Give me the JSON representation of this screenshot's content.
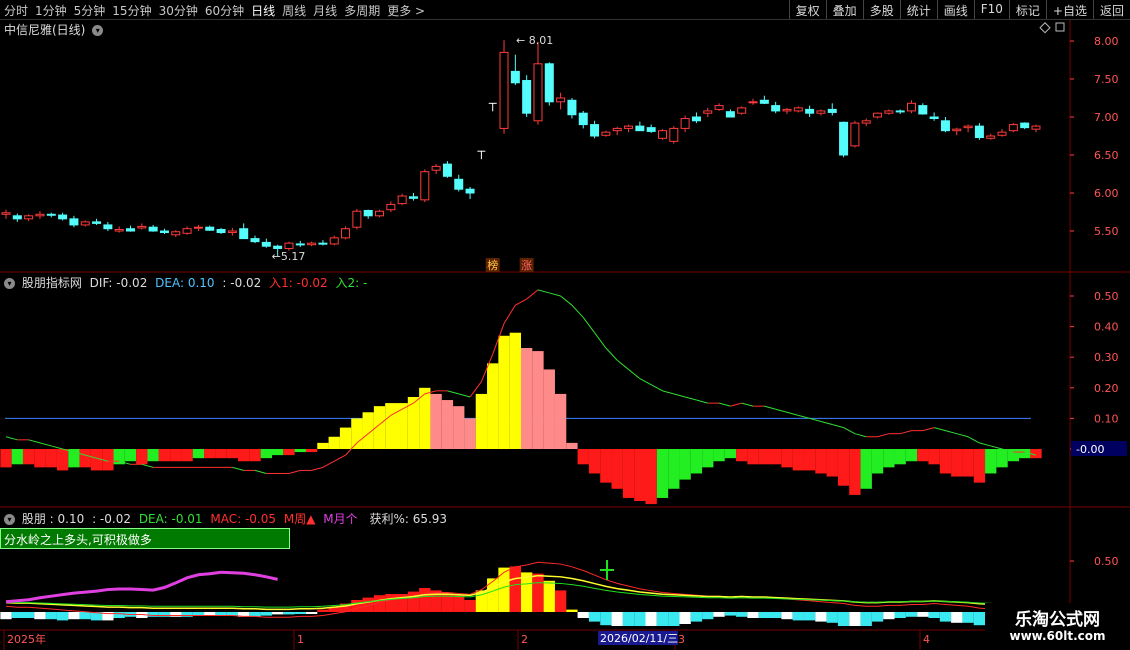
{
  "toolbar": {
    "periods": [
      "分时",
      "1分钟",
      "5分钟",
      "15分钟",
      "30分钟",
      "60分钟",
      "日线",
      "周线",
      "月线",
      "多周期",
      "更多 >"
    ],
    "active_period": "日线",
    "right_buttons": [
      "复权",
      "叠加",
      "多股",
      "统计",
      "画线",
      "F10",
      "标记",
      "+自选",
      "返回"
    ]
  },
  "main": {
    "title": "中信尼雅(日线)",
    "y_ticks": [
      "8.00",
      "7.50",
      "7.00",
      "6.50",
      "6.00",
      "5.50"
    ],
    "high_label": "8.01",
    "low_label": "5.17",
    "badges": [
      "榜",
      "涨"
    ]
  },
  "macd_panel": {
    "title": "股朋指标网",
    "dif_label": "DIF: -0.02",
    "dea_label": "DEA: 0.10",
    "extra1": ": -0.02",
    "entry1": "入1: -0.02",
    "entry2": "入2: -",
    "y_ticks": [
      "0.50",
      "0.40",
      "0.30",
      "0.20",
      "0.10",
      "-0.00"
    ],
    "current_value": "-0.00"
  },
  "bottom_panel": {
    "title": "股朋",
    "val1": ": 0.10",
    "val2": ": -0.02",
    "dea": "DEA: -0.01",
    "mac": "MAC: -0.05",
    "week": "M周▲",
    "month": "M月个",
    "profit": "获利%: 65.93",
    "status_text": "分水岭之上多头,可积极做多",
    "y_tick": "0.50"
  },
  "time_axis": {
    "labels": [
      "2025年",
      "1",
      "2",
      "3",
      "4"
    ],
    "cursor_date": "2026/02/11/三"
  },
  "watermark": {
    "title": "乐淘公式网",
    "url": "www.60lt.com"
  },
  "chart_data": {
    "type": "candlestick",
    "candles": [
      [
        5.72,
        5.78,
        5.66,
        5.74
      ],
      [
        5.7,
        5.73,
        5.62,
        5.66
      ],
      [
        5.66,
        5.72,
        5.63,
        5.7
      ],
      [
        5.7,
        5.76,
        5.66,
        5.72
      ],
      [
        5.72,
        5.74,
        5.68,
        5.71
      ],
      [
        5.71,
        5.74,
        5.64,
        5.66
      ],
      [
        5.66,
        5.7,
        5.55,
        5.58
      ],
      [
        5.58,
        5.64,
        5.56,
        5.62
      ],
      [
        5.62,
        5.66,
        5.58,
        5.6
      ],
      [
        5.58,
        5.62,
        5.5,
        5.53
      ],
      [
        5.5,
        5.56,
        5.48,
        5.52
      ],
      [
        5.53,
        5.57,
        5.49,
        5.5
      ],
      [
        5.54,
        5.6,
        5.52,
        5.56
      ],
      [
        5.55,
        5.58,
        5.49,
        5.5
      ],
      [
        5.5,
        5.53,
        5.46,
        5.48
      ],
      [
        5.45,
        5.51,
        5.42,
        5.49
      ],
      [
        5.47,
        5.56,
        5.45,
        5.53
      ],
      [
        5.54,
        5.58,
        5.5,
        5.55
      ],
      [
        5.55,
        5.57,
        5.5,
        5.51
      ],
      [
        5.52,
        5.54,
        5.46,
        5.48
      ],
      [
        5.48,
        5.54,
        5.44,
        5.5
      ],
      [
        5.53,
        5.6,
        5.5,
        5.4
      ],
      [
        5.4,
        5.44,
        5.34,
        5.36
      ],
      [
        5.35,
        5.4,
        5.28,
        5.3
      ],
      [
        5.3,
        5.32,
        5.17,
        5.27
      ],
      [
        5.27,
        5.36,
        5.24,
        5.34
      ],
      [
        5.33,
        5.37,
        5.29,
        5.32
      ],
      [
        5.32,
        5.36,
        5.3,
        5.34
      ],
      [
        5.34,
        5.38,
        5.31,
        5.33
      ],
      [
        5.33,
        5.44,
        5.31,
        5.41
      ],
      [
        5.41,
        5.56,
        5.39,
        5.53
      ],
      [
        5.55,
        5.79,
        5.52,
        5.76
      ],
      [
        5.77,
        5.78,
        5.66,
        5.7
      ],
      [
        5.7,
        5.78,
        5.68,
        5.76
      ],
      [
        5.78,
        5.89,
        5.75,
        5.85
      ],
      [
        5.86,
        5.99,
        5.84,
        5.96
      ],
      [
        5.95,
        6.0,
        5.9,
        5.93
      ],
      [
        5.91,
        6.31,
        5.88,
        6.28
      ],
      [
        6.3,
        6.38,
        6.25,
        6.35
      ],
      [
        6.38,
        6.42,
        6.2,
        6.22
      ],
      [
        6.18,
        6.24,
        6.02,
        6.05
      ],
      [
        6.05,
        6.08,
        5.92,
        6.0
      ],
      [
        6.55,
        6.55,
        6.55,
        6.55
      ],
      [
        7.18,
        7.18,
        7.18,
        7.18
      ],
      [
        6.85,
        8.01,
        6.78,
        7.85
      ],
      [
        7.6,
        7.82,
        7.42,
        7.45
      ],
      [
        7.48,
        7.55,
        7.0,
        7.05
      ],
      [
        6.95,
        7.99,
        6.9,
        7.7
      ],
      [
        7.7,
        7.72,
        7.15,
        7.2
      ],
      [
        7.2,
        7.32,
        7.1,
        7.25
      ],
      [
        7.22,
        7.25,
        6.98,
        7.03
      ],
      [
        7.05,
        7.08,
        6.85,
        6.9
      ],
      [
        6.9,
        6.95,
        6.72,
        6.75
      ],
      [
        6.76,
        6.82,
        6.74,
        6.8
      ],
      [
        6.82,
        6.87,
        6.76,
        6.85
      ],
      [
        6.85,
        6.9,
        6.8,
        6.88
      ],
      [
        6.88,
        6.94,
        6.82,
        6.82
      ],
      [
        6.86,
        6.9,
        6.79,
        6.81
      ],
      [
        6.72,
        6.84,
        6.7,
        6.82
      ],
      [
        6.68,
        6.88,
        6.65,
        6.85
      ],
      [
        6.85,
        7.02,
        6.8,
        6.98
      ],
      [
        7.0,
        7.06,
        6.92,
        6.95
      ],
      [
        7.05,
        7.12,
        7.0,
        7.08
      ],
      [
        7.1,
        7.18,
        7.08,
        7.15
      ],
      [
        7.07,
        7.1,
        7.0,
        7.0
      ],
      [
        7.05,
        7.14,
        7.03,
        7.12
      ],
      [
        7.2,
        7.24,
        7.16,
        7.2
      ],
      [
        7.22,
        7.28,
        7.17,
        7.18
      ],
      [
        7.15,
        7.2,
        7.05,
        7.08
      ],
      [
        7.08,
        7.12,
        7.04,
        7.1
      ],
      [
        7.08,
        7.14,
        7.06,
        7.12
      ],
      [
        7.1,
        7.15,
        7.0,
        7.05
      ],
      [
        7.05,
        7.1,
        7.02,
        7.08
      ],
      [
        7.1,
        7.18,
        7.02,
        7.06
      ],
      [
        6.93,
        6.94,
        6.47,
        6.5
      ],
      [
        6.62,
        6.95,
        6.6,
        6.92
      ],
      [
        6.92,
        6.98,
        6.88,
        6.95
      ],
      [
        7.0,
        7.06,
        6.98,
        7.05
      ],
      [
        7.05,
        7.1,
        7.03,
        7.08
      ],
      [
        7.08,
        7.1,
        7.04,
        7.07
      ],
      [
        7.08,
        7.22,
        7.05,
        7.18
      ],
      [
        7.15,
        7.18,
        7.03,
        7.04
      ],
      [
        7.0,
        7.06,
        6.95,
        6.98
      ],
      [
        6.95,
        7.0,
        6.8,
        6.82
      ],
      [
        6.82,
        6.86,
        6.76,
        6.84
      ],
      [
        6.86,
        6.9,
        6.8,
        6.88
      ],
      [
        6.88,
        6.92,
        6.7,
        6.73
      ],
      [
        6.72,
        6.78,
        6.7,
        6.75
      ],
      [
        6.76,
        6.84,
        6.74,
        6.8
      ],
      [
        6.82,
        6.92,
        6.8,
        6.9
      ],
      [
        6.92,
        6.93,
        6.84,
        6.86
      ],
      [
        6.84,
        6.9,
        6.8,
        6.88
      ]
    ],
    "macd_hist": [
      -0.06,
      -0.05,
      -0.05,
      -0.06,
      -0.06,
      -0.07,
      -0.06,
      -0.06,
      -0.07,
      -0.07,
      -0.05,
      -0.04,
      -0.05,
      -0.04,
      -0.04,
      -0.04,
      -0.04,
      -0.03,
      -0.03,
      -0.03,
      -0.03,
      -0.04,
      -0.04,
      -0.03,
      -0.02,
      -0.02,
      -0.01,
      -0.01,
      0.02,
      0.04,
      0.07,
      0.1,
      0.12,
      0.14,
      0.15,
      0.15,
      0.17,
      0.2,
      0.18,
      0.16,
      0.14,
      0.1,
      0.18,
      0.28,
      0.37,
      0.38,
      0.33,
      0.32,
      0.26,
      0.18,
      0.02,
      -0.05,
      -0.08,
      -0.11,
      -0.13,
      -0.16,
      -0.17,
      -0.18,
      -0.16,
      -0.13,
      -0.1,
      -0.08,
      -0.06,
      -0.04,
      -0.03,
      -0.04,
      -0.05,
      -0.05,
      -0.05,
      -0.06,
      -0.07,
      -0.07,
      -0.08,
      -0.09,
      -0.12,
      -0.15,
      -0.13,
      -0.08,
      -0.06,
      -0.05,
      -0.04,
      -0.04,
      -0.05,
      -0.08,
      -0.09,
      -0.09,
      -0.11,
      -0.08,
      -0.06,
      -0.04,
      -0.03,
      -0.03
    ],
    "dif": [
      0.04,
      0.03,
      0.03,
      0.02,
      0.01,
      0.0,
      -0.01,
      -0.02,
      -0.03,
      -0.04,
      -0.04,
      -0.05,
      -0.05,
      -0.06,
      -0.06,
      -0.06,
      -0.06,
      -0.06,
      -0.06,
      -0.06,
      -0.06,
      -0.07,
      -0.07,
      -0.08,
      -0.08,
      -0.08,
      -0.07,
      -0.07,
      -0.06,
      -0.04,
      -0.02,
      0.02,
      0.05,
      0.08,
      0.11,
      0.13,
      0.15,
      0.18,
      0.19,
      0.19,
      0.18,
      0.17,
      0.22,
      0.31,
      0.41,
      0.47,
      0.49,
      0.52,
      0.51,
      0.5,
      0.47,
      0.43,
      0.38,
      0.33,
      0.29,
      0.26,
      0.23,
      0.21,
      0.19,
      0.18,
      0.17,
      0.16,
      0.15,
      0.15,
      0.14,
      0.15,
      0.14,
      0.14,
      0.13,
      0.12,
      0.11,
      0.1,
      0.09,
      0.08,
      0.07,
      0.05,
      0.04,
      0.04,
      0.05,
      0.05,
      0.06,
      0.06,
      0.07,
      0.06,
      0.05,
      0.04,
      0.02,
      0.01,
      0.0,
      -0.01,
      -0.01,
      -0.02
    ],
    "dea_level": 0.1
  }
}
